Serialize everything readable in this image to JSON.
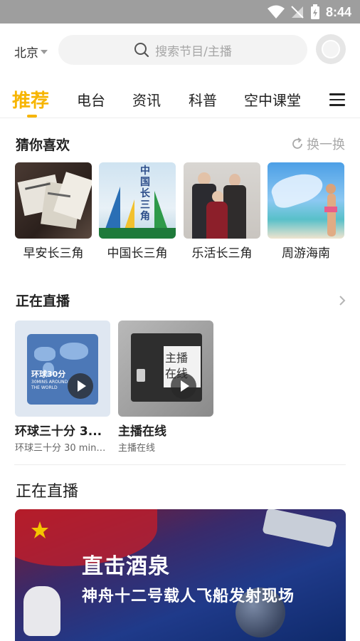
{
  "status_bar": {
    "time": "8:44"
  },
  "header": {
    "city": "北京",
    "search_placeholder": "搜索节目/主播"
  },
  "tabs": [
    "推荐",
    "电台",
    "资讯",
    "科普",
    "空中课堂"
  ],
  "recommend": {
    "title": "猜你喜欢",
    "refresh_label": "换一换",
    "items": [
      {
        "name": "早安长三角",
        "cover_text": ""
      },
      {
        "name": "中国长三角",
        "cover_text": "中国长三角"
      },
      {
        "name": "乐活长三角",
        "cover_text": ""
      },
      {
        "name": "周游海南",
        "cover_text": ""
      }
    ]
  },
  "live": {
    "title": "正在直播",
    "items": [
      {
        "title": "环球三十分 3...",
        "subtitle": "环球三十分 30 minu...",
        "cover_text": "环球30分",
        "cover_sub": "30MINS AROUND THE WORLD"
      },
      {
        "title": "主播在线",
        "subtitle": "主播在线",
        "cover_text": "主播在线"
      }
    ]
  },
  "live_banner": {
    "title": "正在直播",
    "headline": "直击酒泉",
    "subline": "神舟十二号载人飞船发射现场"
  },
  "colors": {
    "accent": "#f7b500",
    "status_bar": "#9e9e9e"
  }
}
